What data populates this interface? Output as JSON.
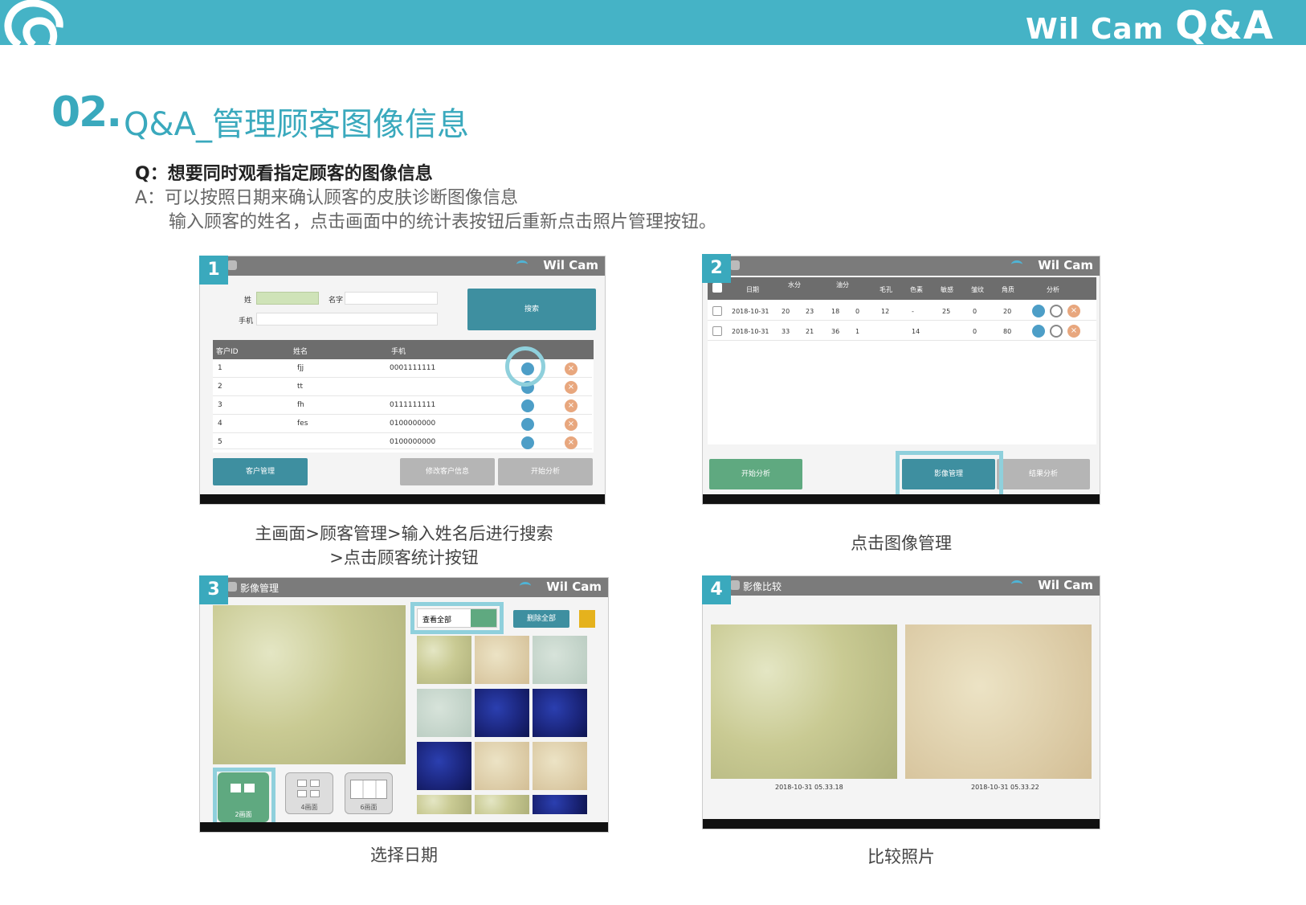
{
  "banner": {
    "brand": "Wil Cam",
    "qa": "Q&A"
  },
  "title": {
    "number": "02.",
    "text": "Q&A_管理顾客图像信息"
  },
  "question": "Q：想要同时观看指定顾客的图像信息",
  "answer_line1": "A：可以按照日期来确认顾客的皮肤诊断图像信息",
  "answer_line2": "输入顾客的姓名，点击画面中的统计表按钮后重新点击照片管理按钮。",
  "panel_brand": "Wil Cam",
  "panels": [
    {
      "num": "1",
      "caption_line1": "主画面>顾客管理>输入姓名后进行搜索",
      "caption_line2": ">点击顾客统计按钮",
      "fields": {
        "name_label": "姓",
        "given_label": "名字",
        "phone_label": "手机"
      },
      "search_button": "搜索",
      "table_headers": [
        "客户ID",
        "姓名",
        "手机"
      ],
      "rows": [
        {
          "id": "1",
          "name": "fjj",
          "phone": "0001111111"
        },
        {
          "id": "2",
          "name": "tt",
          "phone": ""
        },
        {
          "id": "3",
          "name": "fh",
          "phone": "0111111111"
        },
        {
          "id": "4",
          "name": "fes",
          "phone": "0100000000"
        },
        {
          "id": "5",
          "name": "",
          "phone": "0100000000"
        }
      ],
      "buttons": {
        "left": "客户管理",
        "mid": "修改客户信息",
        "right": "开始分析"
      }
    },
    {
      "num": "2",
      "caption": "点击图像管理",
      "headers": [
        "日期",
        "水分",
        "油分",
        "毛孔",
        "色素",
        "敏感",
        "皱纹",
        "角质",
        "分析"
      ],
      "rows": [
        {
          "date": "2018-10-31",
          "vals": [
            "20",
            "23",
            "18",
            "0",
            "12",
            "-",
            "25",
            "0",
            "20"
          ]
        },
        {
          "date": "2018-10-31",
          "vals": [
            "33",
            "21",
            "36",
            "1",
            "",
            "14",
            "",
            "0",
            "80"
          ]
        }
      ],
      "buttons": {
        "left": "开始分析",
        "mid": "影像管理",
        "right": "结果分析"
      }
    },
    {
      "num": "3",
      "title": "影像管理",
      "caption": "选择日期",
      "view_all": "查看全部",
      "delete_all": "删除全部",
      "layout_buttons": [
        "2画面",
        "4画面",
        "6画面"
      ]
    },
    {
      "num": "4",
      "title": "影像比较",
      "caption": "比较照片",
      "left_stamp": "2018-10-31 05.33.18",
      "right_stamp": "2018-10-31 05.33.22"
    }
  ]
}
